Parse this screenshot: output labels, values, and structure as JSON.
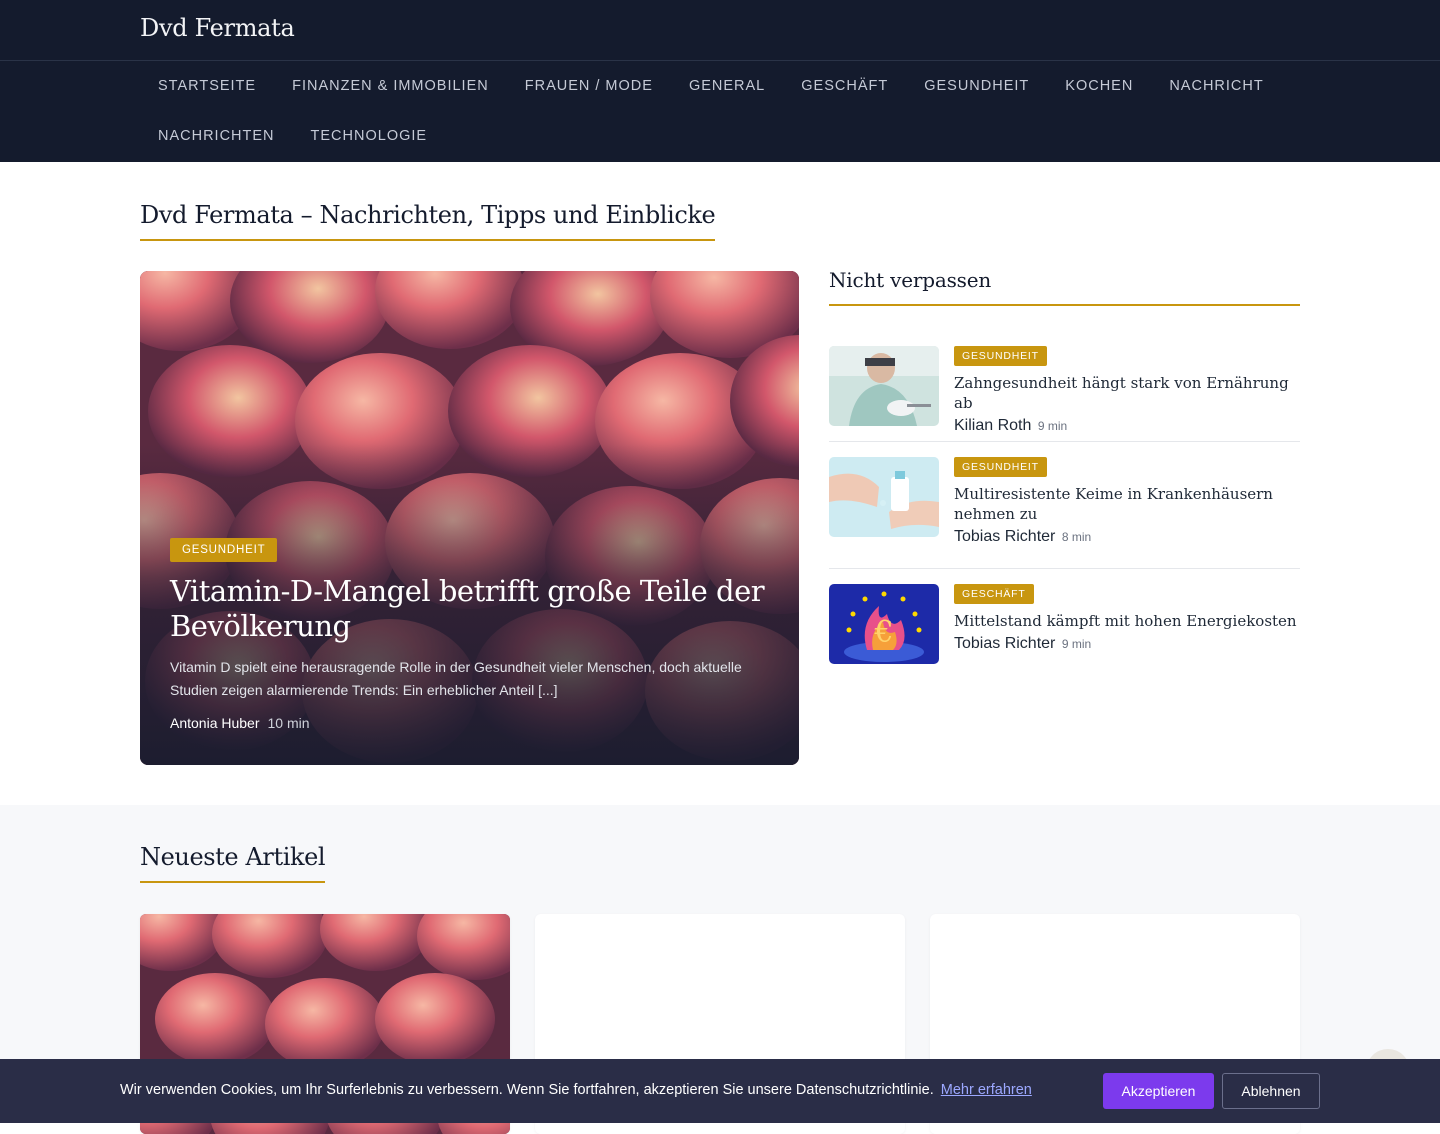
{
  "site": {
    "title": "Dvd Fermata"
  },
  "nav": {
    "items": [
      "STARTSEITE",
      "FINANZEN & IMMOBILIEN",
      "FRAUEN / MODE",
      "GENERAL",
      "GESCHÄFT",
      "GESUNDHEIT",
      "KOCHEN",
      "NACHRICHT",
      "NACHRICHTEN",
      "TECHNOLOGIE"
    ]
  },
  "main": {
    "heading": "Dvd Fermata – Nachrichten, Tipps und Einblicke"
  },
  "hero": {
    "category": "GESUNDHEIT",
    "title": "Vitamin-D-Mangel betrifft große Teile der Bevölkerung",
    "excerpt": "Vitamin D spielt eine herausragende Rolle in der Gesundheit vieler Menschen, doch aktuelle Studien zeigen alarmierende Trends: Ein erheblicher Anteil [...]",
    "author": "Antonia Huber",
    "read_time": "10 min",
    "image_icon": "peaches-image"
  },
  "sidebar": {
    "heading": "Nicht verpassen",
    "items": [
      {
        "category": "GESUNDHEIT",
        "title": "Zahngesundheit hängt stark von Ernährung ab",
        "author": "Kilian Roth",
        "read_time": "9 min",
        "image_icon": "dentist-image"
      },
      {
        "category": "GESUNDHEIT",
        "title": "Multiresistente Keime in Krankenhäusern nehmen zu",
        "author": "Tobias Richter",
        "read_time": "8 min",
        "image_icon": "hand-disinfection-image"
      },
      {
        "category": "GESCHÄFT",
        "title": "Mittelstand kämpft mit hohen Energiekosten",
        "author": "Tobias Richter",
        "read_time": "9 min",
        "image_icon": "euro-flame-image"
      }
    ]
  },
  "latest": {
    "heading": "Neueste Artikel"
  },
  "cookie": {
    "text": "Wir verwenden Cookies, um Ihr Surferlebnis zu verbessern. Wenn Sie fortfahren, akzeptieren Sie unsere Datenschutzrichtlinie.",
    "link": "Mehr erfahren",
    "accept": "Akzeptieren",
    "decline": "Ablehnen"
  },
  "colors": {
    "header_bg": "#141b2d",
    "accent": "#c8960f",
    "cookie_bg": "#2a2d47",
    "accept_button": "#7c3aed"
  }
}
